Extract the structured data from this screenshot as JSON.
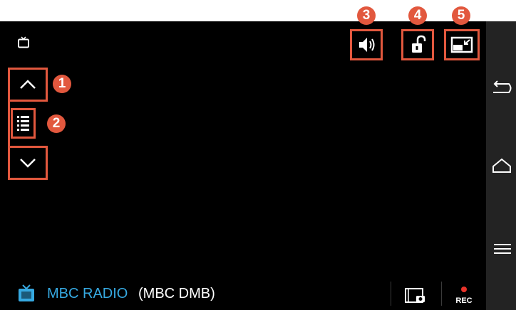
{
  "status_bar": {
    "channel_name": "MBC RADIO",
    "channel_service": "(MBC DMB)",
    "rec_label": "REC"
  },
  "callouts": [
    "1",
    "2",
    "3",
    "4",
    "5"
  ],
  "icons": {
    "top_left": "tv-icon",
    "volume": "volume-icon",
    "lock": "unlock-icon",
    "pip": "picture-in-picture-icon",
    "channel_up": "chevron-up-icon",
    "channel_list": "list-icon",
    "channel_down": "chevron-down-icon",
    "capture": "capture-icon",
    "record": "record-icon",
    "back": "back-icon",
    "home": "home-icon",
    "menu": "menu-icon"
  },
  "colors": {
    "accent_blue": "#36a9e1",
    "callout": "#e2583e",
    "record_red": "#e8332a"
  }
}
